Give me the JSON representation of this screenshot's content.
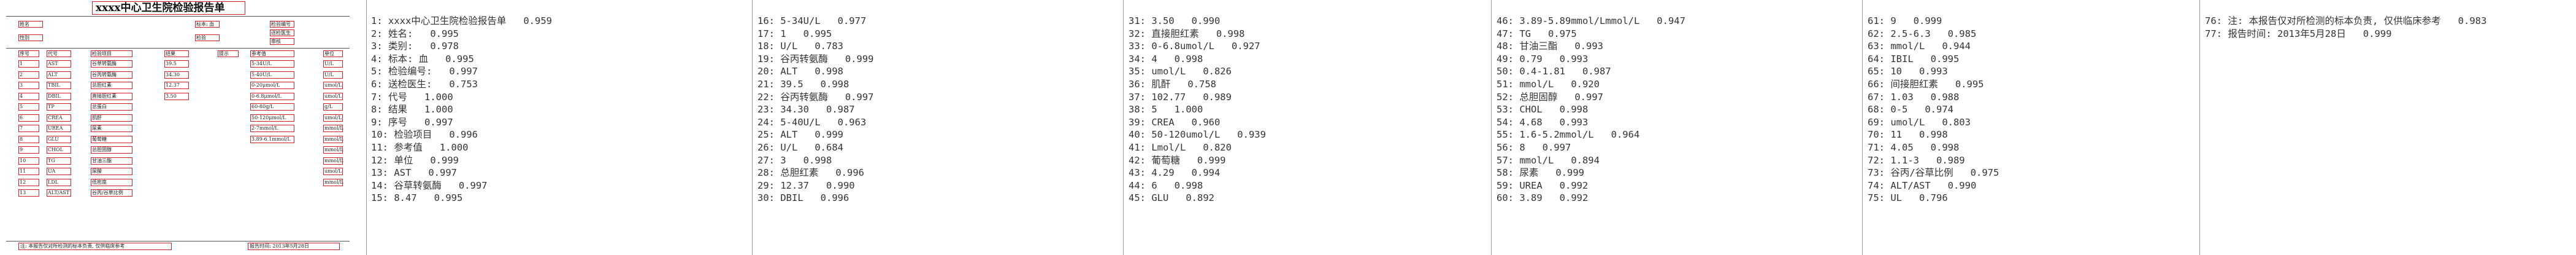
{
  "thumbnail": {
    "title": "xxxx中心卫生院检验报告单",
    "row_labels": [
      "姓名",
      "性别",
      "标本: 血",
      "检验编号",
      "送检医生",
      "检验",
      "审核"
    ],
    "table_headers": [
      "序号",
      "代号",
      "检验项目",
      "结果",
      "提示",
      "参考值",
      "单位"
    ],
    "rows": [
      [
        "1",
        "AST",
        "谷草转氨酶",
        "39.5",
        "",
        "5-34U/L",
        "U/L"
      ],
      [
        "2",
        "ALT",
        "谷丙转氨酶",
        "34.30",
        "",
        "5-40U/L",
        "U/L"
      ],
      [
        "3",
        "TBIL",
        "总胆红素",
        "12.37",
        "",
        "0-20μmol/L",
        "umol/L"
      ],
      [
        "4",
        "DBIL",
        "直接胆红素",
        "3.50",
        "",
        "0-6.8μmol/L",
        "umol/L"
      ],
      [
        "5",
        "TP",
        "总蛋白",
        "",
        "",
        "60-80g/L",
        "g/L"
      ],
      [
        "6",
        "CREA",
        "肌酐",
        "",
        "",
        "50-120μmol/L",
        "umol/L"
      ],
      [
        "7",
        "UREA",
        "尿素",
        "",
        "",
        "2-7mmol/L",
        "mmol/L"
      ],
      [
        "8",
        "GLU",
        "葡萄糖",
        "",
        "",
        "3.89-6.1mmol/L",
        "mmol/L"
      ],
      [
        "9",
        "CHOL",
        "总胆固醇",
        "",
        "",
        "",
        "mmol/L"
      ],
      [
        "10",
        "TG",
        "甘油三酯",
        "",
        "",
        "",
        "mmol/L"
      ],
      [
        "11",
        "UA",
        "尿酸",
        "",
        "",
        "",
        "umol/L"
      ],
      [
        "12",
        "LDL",
        "低密度",
        "",
        "",
        "",
        "mmol/L"
      ],
      [
        "13",
        "ALT/AST",
        "谷丙/谷草比例",
        "",
        "",
        "",
        ""
      ]
    ],
    "footer_left": "注: 本报告仅对所检测的标本负责, 仅供临床参考",
    "footer_right": "报告时间: 2013年5月28日"
  },
  "columns": [
    [
      "1: xxxx中心卫生院检验报告单   0.959",
      "2: 姓名:   0.995",
      "3: 类别:   0.978",
      "4: 标本: 血   0.995",
      "5: 检验编号:   0.997",
      "6: 送检医生:   0.753",
      "7: 代号   1.000",
      "8: 结果   1.000",
      "9: 序号   0.997",
      "10: 检验项目   0.996",
      "11: 参考值   1.000",
      "12: 单位   0.999",
      "13: AST   0.997",
      "14: 谷草转氨酶   0.997",
      "15: 8.47   0.995"
    ],
    [
      "16: 5-34U/L   0.977",
      "17: 1   0.995",
      "18: U/L   0.783",
      "19: 谷丙转氨酶   0.999",
      "20: ALT   0.998",
      "21: 39.5   0.998",
      "22: 谷丙转氨酶   0.997",
      "23: 34.30   0.987",
      "24: 5-40U/L   0.963",
      "25: ALT   0.999",
      "26: U/L   0.684",
      "27: 3   0.998",
      "28: 总胆红素   0.996",
      "29: 12.37   0.990",
      "30: DBIL   0.996"
    ],
    [
      "31: 3.50   0.990",
      "32: 直接胆红素   0.998",
      "33: 0-6.8umol/L   0.927",
      "34: 4   0.998",
      "35: umol/L   0.826",
      "36: 肌酐   0.758",
      "37: 102.77   0.989",
      "38: 5   1.000",
      "39: CREA   0.960",
      "40: 50-120umol/L   0.939",
      "41: Lmol/L   0.820",
      "42: 葡萄糖   0.999",
      "43: 4.29   0.994",
      "44: 6   0.998",
      "45: GLU   0.892"
    ],
    [
      "46: 3.89-5.89mmol/Lmmol/L   0.947",
      "47: TG   0.975",
      "48: 甘油三酯   0.993",
      "49: 0.79   0.993",
      "50: 0.4-1.81   0.987",
      "51: mmol/L   0.920",
      "52: 总胆固醇   0.997",
      "53: CHOL   0.998",
      "54: 4.68   0.993",
      "55: 1.6-5.2mmol/L   0.964",
      "56: 8   0.997",
      "57: mmol/L   0.894",
      "58: 尿素   0.999",
      "59: UREA   0.992",
      "60: 3.89   0.992"
    ],
    [
      "61: 9   0.999",
      "62: 2.5-6.3   0.985",
      "63: mmol/L   0.944",
      "64: IBIL   0.995",
      "65: 10   0.993",
      "66: 间接胆红素   0.995",
      "67: 1.03   0.988",
      "68: 0-5   0.974",
      "69: umol/L   0.803",
      "70: 11   0.998",
      "71: 4.05   0.998",
      "72: 1.1-3   0.989",
      "73: 谷丙/谷草比例   0.975",
      "74: ALT/AST   0.990",
      "75: UL   0.796"
    ],
    [
      "76: 注: 本报告仅对所检测的标本负责, 仅供临床参考   0.983",
      "77: 报告时间: 2013年5月28日   0.999"
    ]
  ]
}
